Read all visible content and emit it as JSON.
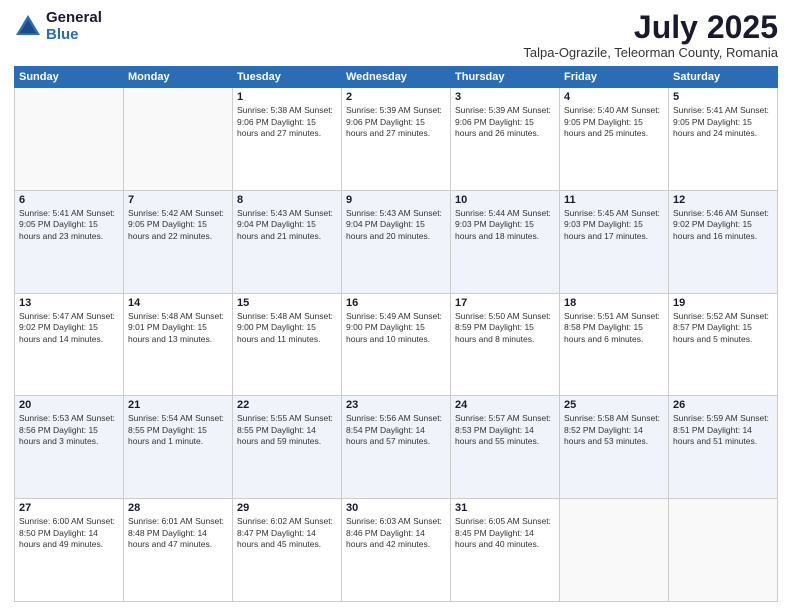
{
  "logo": {
    "general": "General",
    "blue": "Blue"
  },
  "header": {
    "month": "July 2025",
    "location": "Talpa-Ograzile, Teleorman County, Romania"
  },
  "weekdays": [
    "Sunday",
    "Monday",
    "Tuesday",
    "Wednesday",
    "Thursday",
    "Friday",
    "Saturday"
  ],
  "weeks": [
    [
      {
        "day": "",
        "info": ""
      },
      {
        "day": "",
        "info": ""
      },
      {
        "day": "1",
        "info": "Sunrise: 5:38 AM\nSunset: 9:06 PM\nDaylight: 15 hours and 27 minutes."
      },
      {
        "day": "2",
        "info": "Sunrise: 5:39 AM\nSunset: 9:06 PM\nDaylight: 15 hours and 27 minutes."
      },
      {
        "day": "3",
        "info": "Sunrise: 5:39 AM\nSunset: 9:06 PM\nDaylight: 15 hours and 26 minutes."
      },
      {
        "day": "4",
        "info": "Sunrise: 5:40 AM\nSunset: 9:05 PM\nDaylight: 15 hours and 25 minutes."
      },
      {
        "day": "5",
        "info": "Sunrise: 5:41 AM\nSunset: 9:05 PM\nDaylight: 15 hours and 24 minutes."
      }
    ],
    [
      {
        "day": "6",
        "info": "Sunrise: 5:41 AM\nSunset: 9:05 PM\nDaylight: 15 hours and 23 minutes."
      },
      {
        "day": "7",
        "info": "Sunrise: 5:42 AM\nSunset: 9:05 PM\nDaylight: 15 hours and 22 minutes."
      },
      {
        "day": "8",
        "info": "Sunrise: 5:43 AM\nSunset: 9:04 PM\nDaylight: 15 hours and 21 minutes."
      },
      {
        "day": "9",
        "info": "Sunrise: 5:43 AM\nSunset: 9:04 PM\nDaylight: 15 hours and 20 minutes."
      },
      {
        "day": "10",
        "info": "Sunrise: 5:44 AM\nSunset: 9:03 PM\nDaylight: 15 hours and 18 minutes."
      },
      {
        "day": "11",
        "info": "Sunrise: 5:45 AM\nSunset: 9:03 PM\nDaylight: 15 hours and 17 minutes."
      },
      {
        "day": "12",
        "info": "Sunrise: 5:46 AM\nSunset: 9:02 PM\nDaylight: 15 hours and 16 minutes."
      }
    ],
    [
      {
        "day": "13",
        "info": "Sunrise: 5:47 AM\nSunset: 9:02 PM\nDaylight: 15 hours and 14 minutes."
      },
      {
        "day": "14",
        "info": "Sunrise: 5:48 AM\nSunset: 9:01 PM\nDaylight: 15 hours and 13 minutes."
      },
      {
        "day": "15",
        "info": "Sunrise: 5:48 AM\nSunset: 9:00 PM\nDaylight: 15 hours and 11 minutes."
      },
      {
        "day": "16",
        "info": "Sunrise: 5:49 AM\nSunset: 9:00 PM\nDaylight: 15 hours and 10 minutes."
      },
      {
        "day": "17",
        "info": "Sunrise: 5:50 AM\nSunset: 8:59 PM\nDaylight: 15 hours and 8 minutes."
      },
      {
        "day": "18",
        "info": "Sunrise: 5:51 AM\nSunset: 8:58 PM\nDaylight: 15 hours and 6 minutes."
      },
      {
        "day": "19",
        "info": "Sunrise: 5:52 AM\nSunset: 8:57 PM\nDaylight: 15 hours and 5 minutes."
      }
    ],
    [
      {
        "day": "20",
        "info": "Sunrise: 5:53 AM\nSunset: 8:56 PM\nDaylight: 15 hours and 3 minutes."
      },
      {
        "day": "21",
        "info": "Sunrise: 5:54 AM\nSunset: 8:55 PM\nDaylight: 15 hours and 1 minute."
      },
      {
        "day": "22",
        "info": "Sunrise: 5:55 AM\nSunset: 8:55 PM\nDaylight: 14 hours and 59 minutes."
      },
      {
        "day": "23",
        "info": "Sunrise: 5:56 AM\nSunset: 8:54 PM\nDaylight: 14 hours and 57 minutes."
      },
      {
        "day": "24",
        "info": "Sunrise: 5:57 AM\nSunset: 8:53 PM\nDaylight: 14 hours and 55 minutes."
      },
      {
        "day": "25",
        "info": "Sunrise: 5:58 AM\nSunset: 8:52 PM\nDaylight: 14 hours and 53 minutes."
      },
      {
        "day": "26",
        "info": "Sunrise: 5:59 AM\nSunset: 8:51 PM\nDaylight: 14 hours and 51 minutes."
      }
    ],
    [
      {
        "day": "27",
        "info": "Sunrise: 6:00 AM\nSunset: 8:50 PM\nDaylight: 14 hours and 49 minutes."
      },
      {
        "day": "28",
        "info": "Sunrise: 6:01 AM\nSunset: 8:48 PM\nDaylight: 14 hours and 47 minutes."
      },
      {
        "day": "29",
        "info": "Sunrise: 6:02 AM\nSunset: 8:47 PM\nDaylight: 14 hours and 45 minutes."
      },
      {
        "day": "30",
        "info": "Sunrise: 6:03 AM\nSunset: 8:46 PM\nDaylight: 14 hours and 42 minutes."
      },
      {
        "day": "31",
        "info": "Sunrise: 6:05 AM\nSunset: 8:45 PM\nDaylight: 14 hours and 40 minutes."
      },
      {
        "day": "",
        "info": ""
      },
      {
        "day": "",
        "info": ""
      }
    ]
  ]
}
